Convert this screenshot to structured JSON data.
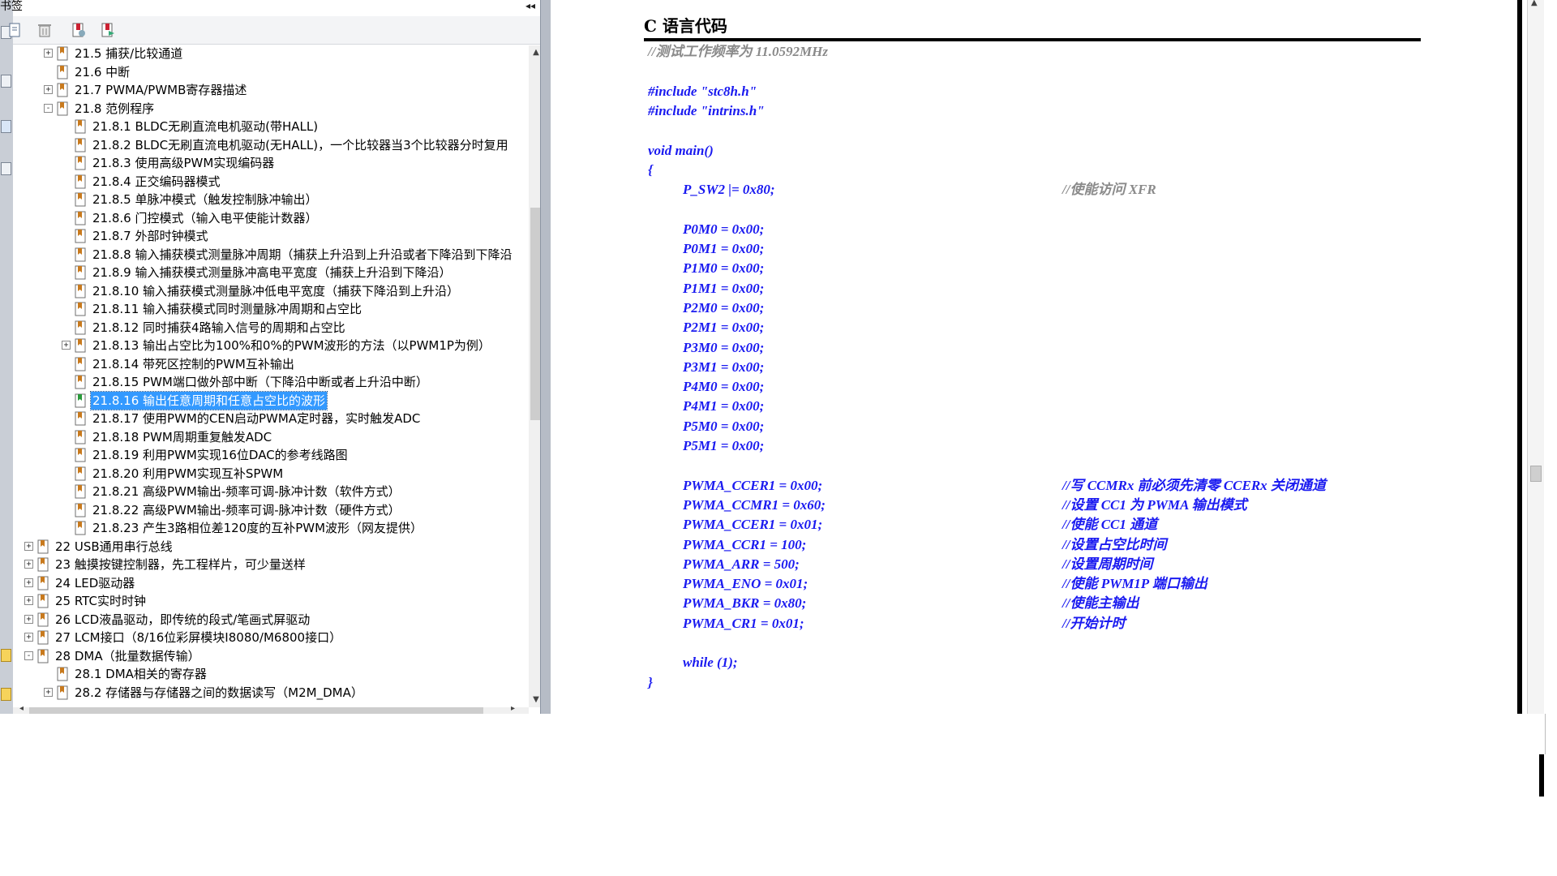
{
  "panel": {
    "title": "书签",
    "collapse_glyph": "◂◂",
    "toolbar": [
      {
        "icon": "bookmark-options-icon"
      },
      {
        "icon": "delete-bookmark-icon"
      },
      {
        "icon": "new-bookmark-icon"
      },
      {
        "icon": "expand-bookmark-icon"
      }
    ]
  },
  "tree": [
    {
      "level": 1,
      "expander": "+",
      "label": "21.5 捕获/比较通道"
    },
    {
      "level": 1,
      "expander": "",
      "label": "21.6 中断"
    },
    {
      "level": 1,
      "expander": "+",
      "label": "21.7 PWMA/PWMB寄存器描述"
    },
    {
      "level": 1,
      "expander": "-",
      "label": "21.8 范例程序"
    },
    {
      "level": 2,
      "expander": "",
      "label": "21.8.1 BLDC无刷直流电机驱动(带HALL)"
    },
    {
      "level": 2,
      "expander": "",
      "label": "21.8.2 BLDC无刷直流电机驱动(无HALL)，一个比较器当3个比较器分时复用"
    },
    {
      "level": 2,
      "expander": "",
      "label": "21.8.3 使用高级PWM实现编码器"
    },
    {
      "level": 2,
      "expander": "",
      "label": "21.8.4 正交编码器模式"
    },
    {
      "level": 2,
      "expander": "",
      "label": "21.8.5 单脉冲模式（触发控制脉冲输出）"
    },
    {
      "level": 2,
      "expander": "",
      "label": "21.8.6 门控模式（输入电平使能计数器）"
    },
    {
      "level": 2,
      "expander": "",
      "label": "21.8.7 外部时钟模式"
    },
    {
      "level": 2,
      "expander": "",
      "label": "21.8.8 输入捕获模式测量脉冲周期（捕获上升沿到上升沿或者下降沿到下降沿"
    },
    {
      "level": 2,
      "expander": "",
      "label": "21.8.9 输入捕获模式测量脉冲高电平宽度（捕获上升沿到下降沿）"
    },
    {
      "level": 2,
      "expander": "",
      "label": "21.8.10 输入捕获模式测量脉冲低电平宽度（捕获下降沿到上升沿）"
    },
    {
      "level": 2,
      "expander": "",
      "label": "21.8.11 输入捕获模式同时测量脉冲周期和占空比"
    },
    {
      "level": 2,
      "expander": "",
      "label": "21.8.12 同时捕获4路输入信号的周期和占空比"
    },
    {
      "level": 2,
      "expander": "+",
      "label": "21.8.13 输出占空比为100%和0%的PWM波形的方法（以PWM1P为例）"
    },
    {
      "level": 2,
      "expander": "",
      "label": "21.8.14 带死区控制的PWM互补输出"
    },
    {
      "level": 2,
      "expander": "",
      "label": "21.8.15 PWM端口做外部中断（下降沿中断或者上升沿中断）"
    },
    {
      "level": 2,
      "expander": "",
      "label": "21.8.16 输出任意周期和任意占空比的波形",
      "selected": true
    },
    {
      "level": 2,
      "expander": "",
      "label": "21.8.17 使用PWM的CEN启动PWMA定时器，实时触发ADC"
    },
    {
      "level": 2,
      "expander": "",
      "label": "21.8.18 PWM周期重复触发ADC"
    },
    {
      "level": 2,
      "expander": "",
      "label": "21.8.19 利用PWM实现16位DAC的参考线路图"
    },
    {
      "level": 2,
      "expander": "",
      "label": "21.8.20 利用PWM实现互补SPWM"
    },
    {
      "level": 2,
      "expander": "",
      "label": "21.8.21 高级PWM输出-频率可调-脉冲计数（软件方式）"
    },
    {
      "level": 2,
      "expander": "",
      "label": "21.8.22 高级PWM输出-频率可调-脉冲计数（硬件方式）"
    },
    {
      "level": 2,
      "expander": "",
      "label": "21.8.23 产生3路相位差120度的互补PWM波形（网友提供）"
    },
    {
      "level": 0,
      "expander": "+",
      "label": "22 USB通用串行总线"
    },
    {
      "level": 0,
      "expander": "+",
      "label": "23 触摸按键控制器，先工程样片，可少量送样"
    },
    {
      "level": 0,
      "expander": "+",
      "label": "24 LED驱动器"
    },
    {
      "level": 0,
      "expander": "+",
      "label": "25 RTC实时时钟"
    },
    {
      "level": 0,
      "expander": "+",
      "label": "26 LCD液晶驱动，即传统的段式/笔画式屏驱动"
    },
    {
      "level": 0,
      "expander": "+",
      "label": "27 LCM接口（8/16位彩屏模块I8080/M6800接口）"
    },
    {
      "level": 0,
      "expander": "-",
      "label": "28 DMA（批量数据传输）"
    },
    {
      "level": 1,
      "expander": "",
      "label": "28.1 DMA相关的寄存器"
    },
    {
      "level": 1,
      "expander": "+",
      "label": "28.2 存储器与存储器之间的数据读写（M2M_DMA）"
    }
  ],
  "document": {
    "heading": "C 语言代码",
    "lines": [
      {
        "code": "//测试工作频率为 11.0592MHz",
        "style": "gray",
        "row": 0,
        "indent": 0
      },
      {
        "code": "#include \"stc8h.h\"",
        "row": 2,
        "indent": 0
      },
      {
        "code": "#include \"intrins.h\"",
        "row": 3,
        "indent": 0
      },
      {
        "code": "void main()",
        "row": 5,
        "indent": 0
      },
      {
        "code": "{",
        "row": 6,
        "indent": 0
      },
      {
        "code": "P_SW2 |= 0x80;",
        "comment": "//使能访问 XFR",
        "comment_style": "comment-gray",
        "row": 7,
        "indent": 1
      },
      {
        "code": "P0M0 = 0x00;",
        "row": 9,
        "indent": 1
      },
      {
        "code": "P0M1 = 0x00;",
        "row": 10,
        "indent": 1
      },
      {
        "code": "P1M0 = 0x00;",
        "row": 11,
        "indent": 1
      },
      {
        "code": "P1M1 = 0x00;",
        "row": 12,
        "indent": 1
      },
      {
        "code": "P2M0 = 0x00;",
        "row": 13,
        "indent": 1
      },
      {
        "code": "P2M1 = 0x00;",
        "row": 14,
        "indent": 1
      },
      {
        "code": "P3M0 = 0x00;",
        "row": 15,
        "indent": 1
      },
      {
        "code": "P3M1 = 0x00;",
        "row": 16,
        "indent": 1
      },
      {
        "code": "P4M0 = 0x00;",
        "row": 17,
        "indent": 1
      },
      {
        "code": "P4M1 = 0x00;",
        "row": 18,
        "indent": 1
      },
      {
        "code": "P5M0 = 0x00;",
        "row": 19,
        "indent": 1
      },
      {
        "code": "P5M1 = 0x00;",
        "row": 20,
        "indent": 1
      },
      {
        "code": "PWMA_CCER1 = 0x00;",
        "comment": "//写 CCMRx 前必须先清零 CCERx 关闭通道",
        "row": 22,
        "indent": 1
      },
      {
        "code": "PWMA_CCMR1 = 0x60;",
        "comment": "//设置 CC1 为 PWMA 输出模式",
        "row": 23,
        "indent": 1
      },
      {
        "code": "PWMA_CCER1 = 0x01;",
        "comment": "//使能 CC1 通道",
        "row": 24,
        "indent": 1
      },
      {
        "code": "PWMA_CCR1 = 100;",
        "comment": "//设置占空比时间",
        "row": 25,
        "indent": 1
      },
      {
        "code": "PWMA_ARR = 500;",
        "comment": "//设置周期时间",
        "row": 26,
        "indent": 1
      },
      {
        "code": "PWMA_ENO = 0x01;",
        "comment": "//使能 PWM1P 端口输出",
        "row": 27,
        "indent": 1
      },
      {
        "code": "PWMA_BKR = 0x80;",
        "comment": "//使能主输出",
        "row": 28,
        "indent": 1
      },
      {
        "code": "PWMA_CR1 = 0x01;",
        "comment": "//开始计时",
        "row": 29,
        "indent": 1
      },
      {
        "code": "while (1);",
        "row": 31,
        "indent": 1
      },
      {
        "code": "}",
        "row": 32,
        "indent": 0
      }
    ]
  },
  "colors": {
    "code": "#1a1af0",
    "comment_gray": "#8a8a8a",
    "selection": "#3399ff"
  }
}
